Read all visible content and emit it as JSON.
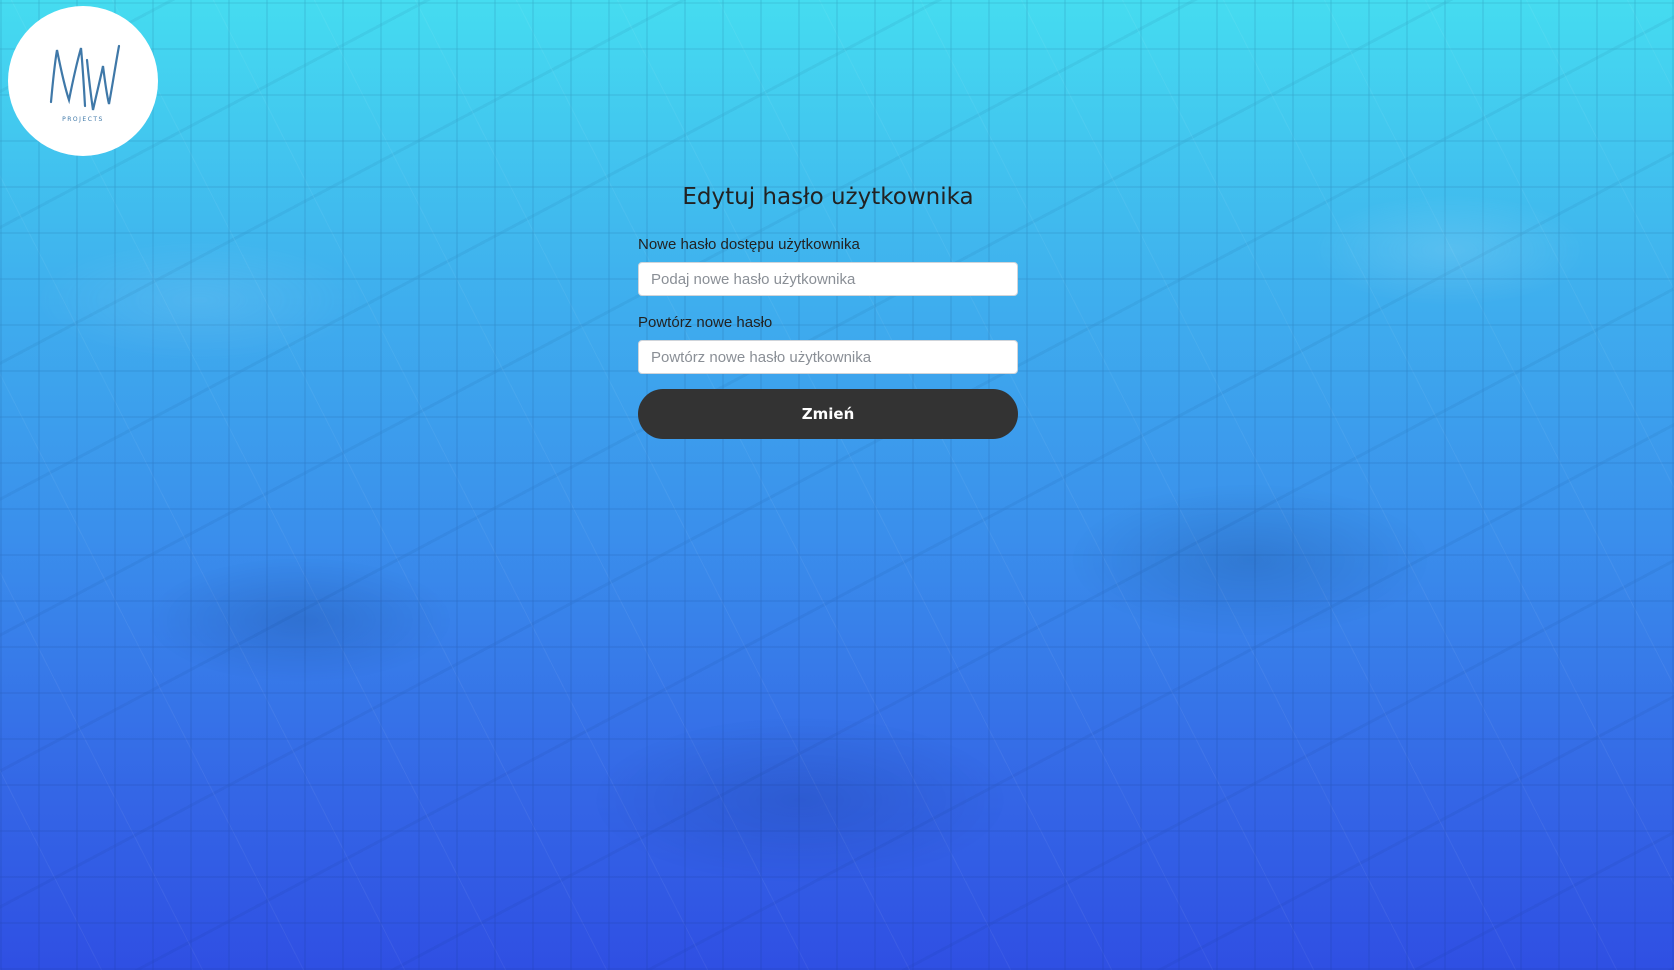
{
  "logo": {
    "monogram": "MW",
    "subtitle": "PROJECTS"
  },
  "form": {
    "title": "Edytuj hasło użytkownika",
    "new_password": {
      "label": "Nowe hasło dostępu użytkownika",
      "placeholder": "Podaj nowe hasło użytkownika",
      "value": ""
    },
    "repeat_password": {
      "label": "Powtórz nowe hasło",
      "placeholder": "Powtórz nowe hasło użytkownika",
      "value": ""
    },
    "submit_label": "Zmień"
  },
  "colors": {
    "gradient_top": "#45dcf0",
    "gradient_bottom": "#2f4fe3",
    "button_bg": "#333333",
    "logo_ink": "#3f78a8"
  }
}
